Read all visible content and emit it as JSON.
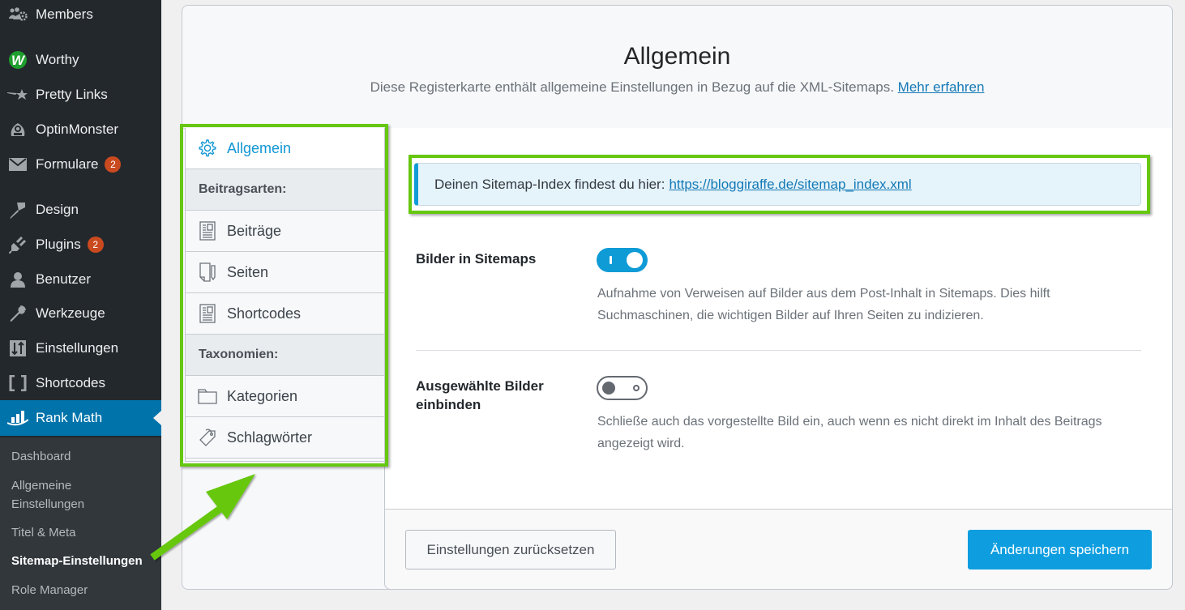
{
  "sidebar": {
    "items": [
      {
        "label": "Members",
        "icon": "members-icon"
      },
      {
        "label": "Worthy",
        "icon": "worthy-icon"
      },
      {
        "label": "Pretty Links",
        "icon": "pretty-links-icon"
      },
      {
        "label": "OptinMonster",
        "icon": "optinmonster-icon"
      },
      {
        "label": "Formulare",
        "icon": "mail-icon",
        "badge": "2"
      },
      {
        "label": "Design",
        "icon": "paintbrush-icon"
      },
      {
        "label": "Plugins",
        "icon": "plug-icon",
        "badge": "2"
      },
      {
        "label": "Benutzer",
        "icon": "user-icon"
      },
      {
        "label": "Werkzeuge",
        "icon": "wrench-icon"
      },
      {
        "label": "Einstellungen",
        "icon": "settings-sliders-icon"
      },
      {
        "label": "Shortcodes",
        "icon": "brackets-icon"
      },
      {
        "label": "Rank Math",
        "icon": "rank-math-icon",
        "current": true
      }
    ],
    "submenu": [
      {
        "label": "Dashboard"
      },
      {
        "label": "Allgemeine Einstellungen"
      },
      {
        "label": "Titel & Meta"
      },
      {
        "label": "Sitemap-Einstellungen",
        "current": true
      },
      {
        "label": "Role Manager"
      }
    ]
  },
  "header": {
    "title": "Allgemein",
    "description": "Diese Registerkarte enthält allgemeine Einstellungen in Bezug auf die XML-Sitemaps.",
    "learn_more": "Mehr erfahren"
  },
  "tabs": {
    "active": {
      "label": "Allgemein",
      "icon": "gear-icon"
    },
    "groups": [
      {
        "heading": "Beitragsarten:",
        "items": [
          {
            "label": "Beiträge",
            "icon": "post-icon"
          },
          {
            "label": "Seiten",
            "icon": "page-icon"
          },
          {
            "label": "Shortcodes",
            "icon": "post-icon"
          }
        ]
      },
      {
        "heading": "Taxonomien:",
        "items": [
          {
            "label": "Kategorien",
            "icon": "folder-icon"
          },
          {
            "label": "Schlagwörter",
            "icon": "tag-icon"
          }
        ]
      }
    ]
  },
  "notice": {
    "text": "Deinen Sitemap-Index findest du hier:",
    "link": "https://bloggiraffe.de/sitemap_index.xml"
  },
  "fields": [
    {
      "label": "Bilder in Sitemaps",
      "enabled": true,
      "description": "Aufnahme von Verweisen auf Bilder aus dem Post-Inhalt in Sitemaps. Dies hilft Suchmaschinen, die wichtigen Bilder auf Ihren Seiten zu indizieren."
    },
    {
      "label": "Ausgewählte Bilder einbinden",
      "enabled": false,
      "description": "Schließe auch das vorgestellte Bild ein, auch wenn es nicht direkt im Inhalt des Beitrags angezeigt wird."
    }
  ],
  "footer": {
    "reset_label": "Einstellungen zurücksetzen",
    "save_label": "Änderungen speichern"
  },
  "colors": {
    "accent": "#0e9bd6",
    "admin_current": "#0073aa",
    "badge": "#ca4a1f",
    "highlight": "#66c70f"
  }
}
